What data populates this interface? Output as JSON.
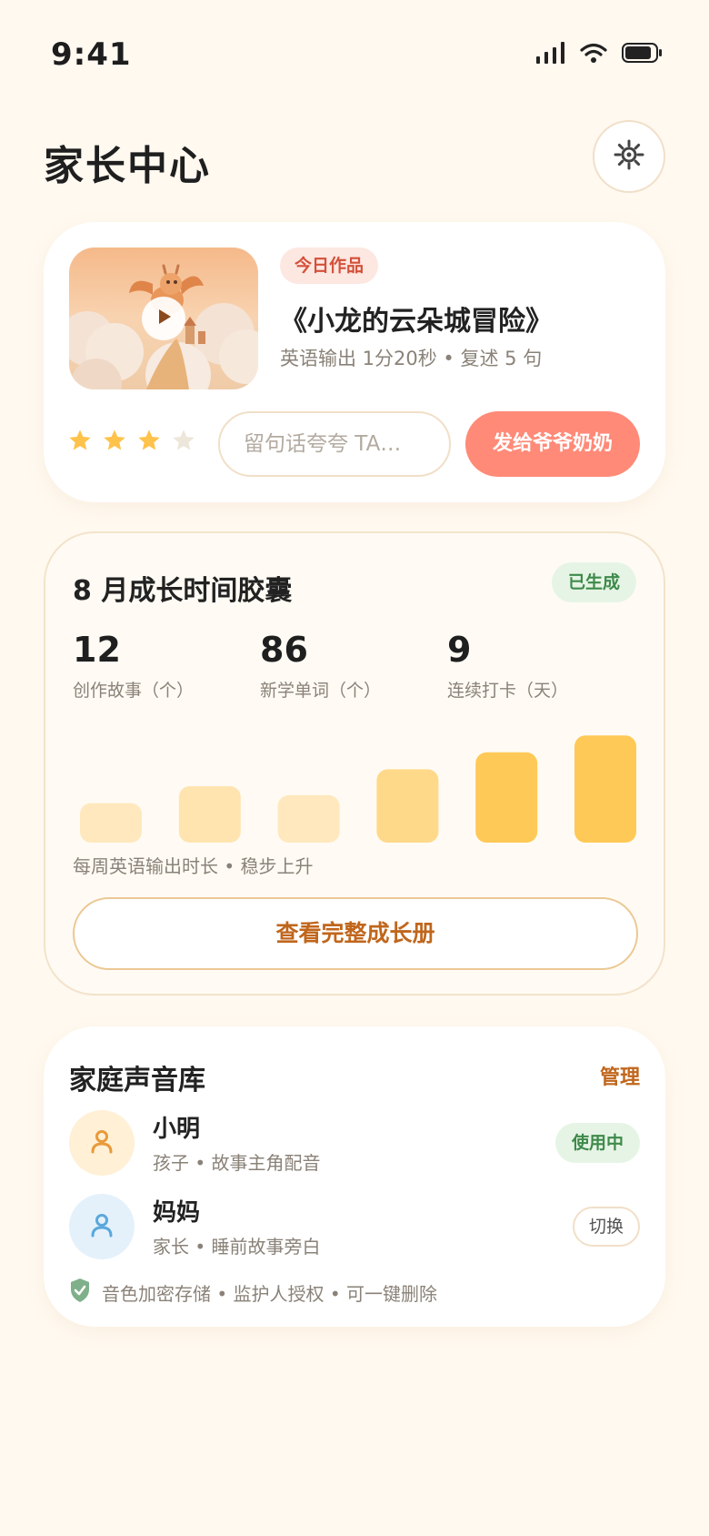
{
  "status_bar": {
    "time": "9:41"
  },
  "header": {
    "title": "家长中心"
  },
  "work_card": {
    "tag": "今日作品",
    "title": "《小龙的云朵城冒险》",
    "meta": "英语输出 1分20秒 • 复述 5 句",
    "rating": 3,
    "rating_max": 4,
    "comment_placeholder": "留句话夸夸 TA…",
    "send_label": "发给爷爷奶奶"
  },
  "capsule": {
    "title": "8 月成长时间胶囊",
    "status": "已生成",
    "stats": [
      {
        "value": "12",
        "label": "创作故事（个）"
      },
      {
        "value": "86",
        "label": "新学单词（个）"
      },
      {
        "value": "9",
        "label": "连续打卡（天）"
      }
    ],
    "chart_caption": "每周英语输出时长 • 稳步上升",
    "button_label": "查看完整成长册"
  },
  "chart_data": {
    "type": "bar",
    "categories": [
      "",
      "",
      "",
      "",
      "",
      ""
    ],
    "values": [
      35,
      50,
      42,
      65,
      80,
      95
    ],
    "ylim": [
      0,
      100
    ],
    "title": "",
    "xlabel": "",
    "ylabel": "",
    "colors": [
      "#FFE8BD",
      "#FFE4B0",
      "#FFE8BD",
      "#FFD98A",
      "#FFC957",
      "#FFC957"
    ]
  },
  "voice_library": {
    "title": "家庭声音库",
    "manage_label": "管理",
    "voices": [
      {
        "name": "小明",
        "desc": "孩子 • 故事主角配音",
        "action": "使用中",
        "active": true
      },
      {
        "name": "妈妈",
        "desc": "家长 • 睡前故事旁白",
        "action": "切换",
        "active": false
      }
    ],
    "privacy_note": "音色加密存储 • 监护人授权 • 可一键删除"
  },
  "colors": {
    "background": "#FFF9F0",
    "accent": "#FF8A78",
    "brand_orange": "#C0661C",
    "success_green": "#3E8A4A",
    "star": "#FFC24A"
  }
}
